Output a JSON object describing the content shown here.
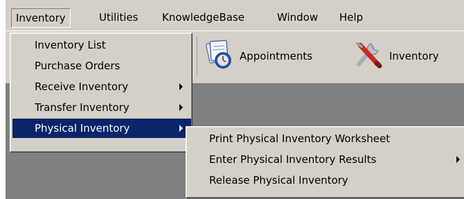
{
  "menubar": {
    "items": [
      "Inventory",
      "Utilities",
      "KnowledgeBase",
      "Window",
      "Help"
    ]
  },
  "toolbar": {
    "appointments_label": "Appointments",
    "inventory_label": "Inventory"
  },
  "inventory_menu": {
    "items": [
      "Inventory List",
      "Purchase Orders",
      "Receive Inventory",
      "Transfer Inventory",
      "Physical Inventory"
    ]
  },
  "physical_inventory_submenu": {
    "items": [
      "Print Physical Inventory Worksheet",
      "Enter Physical Inventory Results",
      "Release Physical Inventory"
    ]
  },
  "colors": {
    "face": "#d4d0c8",
    "highlight": "#0a246a",
    "workspace": "#808080"
  }
}
